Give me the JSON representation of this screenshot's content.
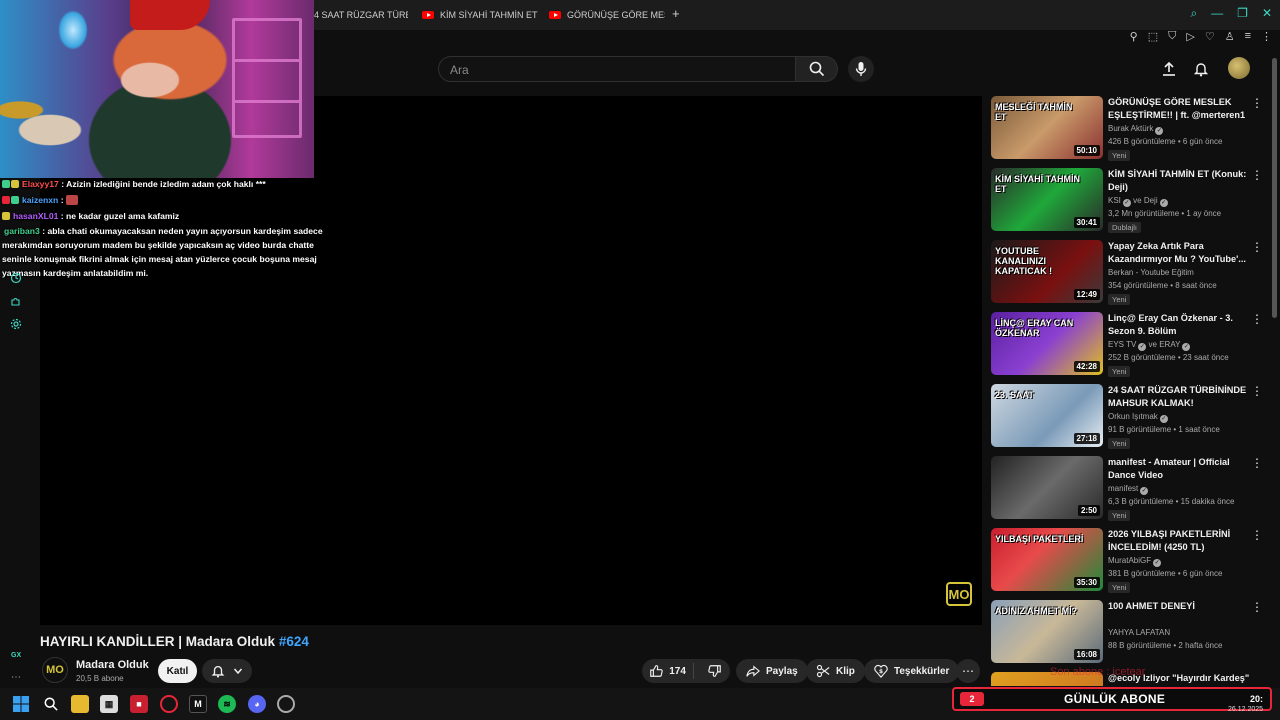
{
  "browser": {
    "tabs": [
      {
        "label": "4 SAAT RÜZGAR TÜRBİ",
        "has_icon": false
      },
      {
        "label": "KİM SİYAHİ TAHMİN ET (",
        "has_icon": true
      },
      {
        "label": "GÖRÜNÜŞE GÖRE MESLE",
        "has_icon": true
      }
    ],
    "new_tab": "+"
  },
  "header": {
    "search_placeholder": "Ara"
  },
  "chat": [
    {
      "user": "Elaxyy17",
      "user_color": "#ff4d4d",
      "message": ": Azizin izlediğini bende izledim adam çok haklı ***",
      "emote": false
    },
    {
      "user": "kaizenxn",
      "user_color": "#4aa3ff",
      "message": ":",
      "emote": true
    },
    {
      "user": "hasanXL01",
      "user_color": "#b45cff",
      "message": ": ne kadar guzel ama kafamiz",
      "emote": false
    },
    {
      "user": "gariban3",
      "user_color": "#3ecf8e",
      "message": ": abla chati okumayacaksan neden yayın açıyorsun kardeşim sadece merakımdan soruyorum madem bu şekilde yapıcaksın aç video burda chatte seninle konuşmak fikrini almak için mesaj atan yüzlerce çocuk boşuna mesaj yazmasın kardeşim anlatabildim mi.",
      "emote": false
    }
  ],
  "video": {
    "title": "HAYIRLI KANDİLLER | Madara Olduk",
    "hashtag": "#624",
    "watermark": "MO"
  },
  "channel": {
    "avatar_text": "MO",
    "name": "Madara Olduk",
    "subs": "20,5 B abone",
    "join": "Katıl"
  },
  "actions": {
    "likes": "174",
    "share": "Paylaş",
    "clip": "Klip",
    "thanks": "Teşekkürler"
  },
  "recommendations": [
    {
      "title": "GÖRÜNÜŞE GÖRE MESLEK EŞLEŞTİRME!! | ft. @merteren1",
      "channel": "Burak Aktürk",
      "verified": true,
      "co_channel": "",
      "meta": "426 B görüntüleme • 6 gün önce",
      "badge": "Yeni",
      "duration": "50:10",
      "thumb_text": "MESLEĞİ TAHMİN ET",
      "thumb_bg": "linear-gradient(135deg,#7a5a3a,#c99a6a 50%,#8a3030)"
    },
    {
      "title": "KİM SİYAHİ TAHMİN ET (Konuk: Deji)",
      "channel": "KSI",
      "verified": true,
      "co_channel": "ve Deji",
      "meta": "3,2 Mn görüntüleme • 1 ay önce",
      "badge": "Dublajlı",
      "duration": "30:41",
      "thumb_text": "KİM SİYAHİ TAHMİN ET",
      "thumb_bg": "linear-gradient(135deg,#2a2a2a,#1fa83a 50%,#2a2a2a)"
    },
    {
      "title": "Yapay Zeka Artık Para Kazandırmıyor Mu ? YouTube'...",
      "channel": "Berkan - Youtube Eğitim",
      "verified": false,
      "co_channel": "",
      "meta": "354 görüntüleme • 8 saat önce",
      "badge": "Yeni",
      "duration": "12:49",
      "thumb_text": "YOUTUBE KANALINIZI KAPATICAK !",
      "thumb_bg": "linear-gradient(135deg,#1a1a1a,#7a1010 60%,#3a3a3a)"
    },
    {
      "title": "Linç@ Eray Can Özkenar - 3. Sezon 9. Bölüm",
      "channel": "EYS TV",
      "verified": true,
      "co_channel": "ve ERAY",
      "meta": "252 B görüntüleme • 23 saat önce",
      "badge": "Yeni",
      "duration": "42:28",
      "thumb_text": "LİNÇ@ ERAY CAN ÖZKENAR",
      "thumb_bg": "linear-gradient(135deg,#5a20a0,#8a40d0 50%,#e0c020)"
    },
    {
      "title": "24 SAAT RÜZGAR TÜRBİNİNDE MAHSUR KALMAK!",
      "channel": "Orkun Işıtmak",
      "verified": true,
      "co_channel": "",
      "meta": "91 B görüntüleme • 1 saat önce",
      "badge": "Yeni",
      "duration": "27:18",
      "thumb_text": "23. SAAT",
      "thumb_bg": "linear-gradient(135deg,#cfd8e0,#7a9ab8 60%,#e8eef2)"
    },
    {
      "title": "manifest - Amateur | Official Dance Video",
      "channel": "manifest",
      "verified": true,
      "co_channel": "",
      "meta": "6,3 B görüntüleme • 15 dakika önce",
      "badge": "Yeni",
      "duration": "2:50",
      "thumb_text": "",
      "thumb_bg": "linear-gradient(135deg,#222,#6a6a6a 50%,#2a2a2a)"
    },
    {
      "title": "2026 YILBAŞI PAKETLERİNİ İNCELEDİM! (4250 TL)",
      "channel": "MuratAbiGF",
      "verified": true,
      "co_channel": "",
      "meta": "381 B görüntüleme • 6 gün önce",
      "badge": "Yeni",
      "duration": "35:30",
      "thumb_text": "YILBAŞI PAKETLERİ",
      "thumb_bg": "linear-gradient(135deg,#c81e2e,#e84a4a 40%,#1e8a3a)"
    },
    {
      "title": "100 AHMET DENEYİ",
      "channel": "YAHYA LAFATAN",
      "verified": false,
      "co_channel": "",
      "meta": "88 B görüntüleme • 2 hafta önce",
      "badge": "",
      "duration": "16:08",
      "thumb_text": "ADINIZ AHMET Mİ?",
      "thumb_bg": "linear-gradient(135deg,#8aa0b8,#c8b898 50%,#5a6a7a)"
    }
  ],
  "partial_rec_title": "@ecoly lzliyor \"Hayırdır Kardeş\"",
  "taskbar": {
    "sub_count": "2",
    "sub_label": "GÜNLÜK ABONE",
    "ghost_text": "Son abone : icetear",
    "time": "20:",
    "date": "26.12.2025"
  },
  "colors": {
    "accent_teal": "#3ed6c0",
    "sub_red": "#e8263a",
    "link_blue": "#3ea6ff",
    "yt_red": "#ff0000"
  }
}
